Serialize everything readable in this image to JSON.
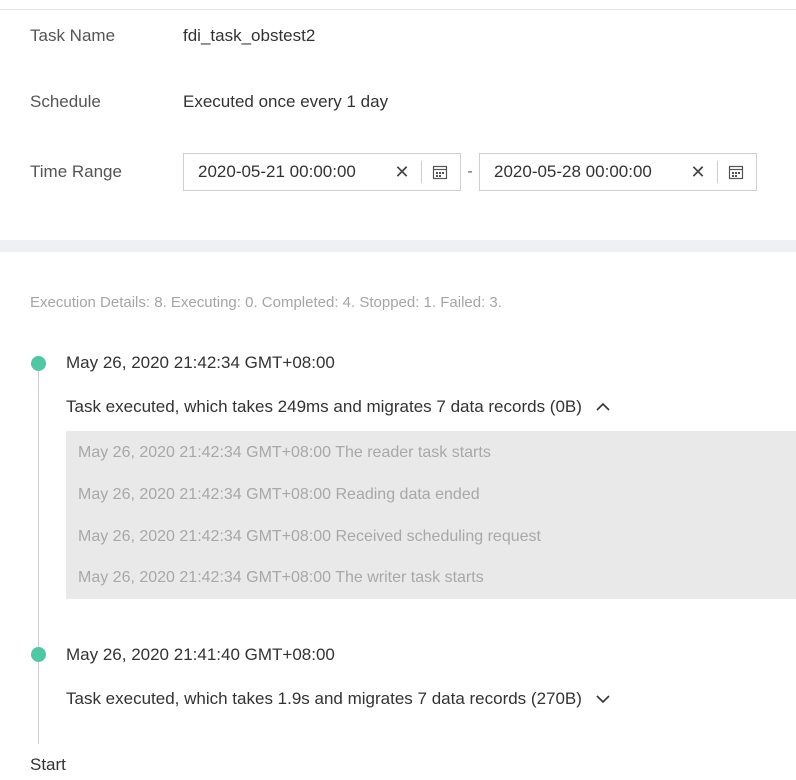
{
  "task": {
    "name_label": "Task Name",
    "name_value": "fdi_task_obstest2",
    "schedule_label": "Schedule",
    "schedule_value": "Executed once every 1 day",
    "time_range_label": "Time Range",
    "start_date": "2020-05-21 00:00:00",
    "end_date": "2020-05-28 00:00:00",
    "range_separator": "-"
  },
  "summary": "Execution Details: 8. Executing: 0. Completed: 4. Stopped: 1. Failed: 3.",
  "executions": [
    {
      "time": "May 26, 2020 21:42:34 GMT+08:00",
      "description": "Task executed, which takes 249ms and migrates 7 data records (0B)",
      "expanded": true,
      "status_color": "#4fc6a4",
      "logs": [
        "May 26, 2020 21:42:34 GMT+08:00 The reader task starts",
        "May 26, 2020 21:42:34 GMT+08:00 Reading data ended",
        "May 26, 2020 21:42:34 GMT+08:00 Received scheduling request",
        "May 26, 2020 21:42:34 GMT+08:00 The writer task starts"
      ]
    },
    {
      "time": "May 26, 2020 21:41:40 GMT+08:00",
      "description": "Task executed, which takes 1.9s and migrates 7 data records (270B)",
      "expanded": false,
      "status_color": "#4fc6a4"
    }
  ],
  "start_label": "Start",
  "icons": {
    "clear": "close-icon",
    "calendar": "calendar-icon",
    "collapse": "chevron-up-icon",
    "expand": "chevron-down-icon"
  }
}
